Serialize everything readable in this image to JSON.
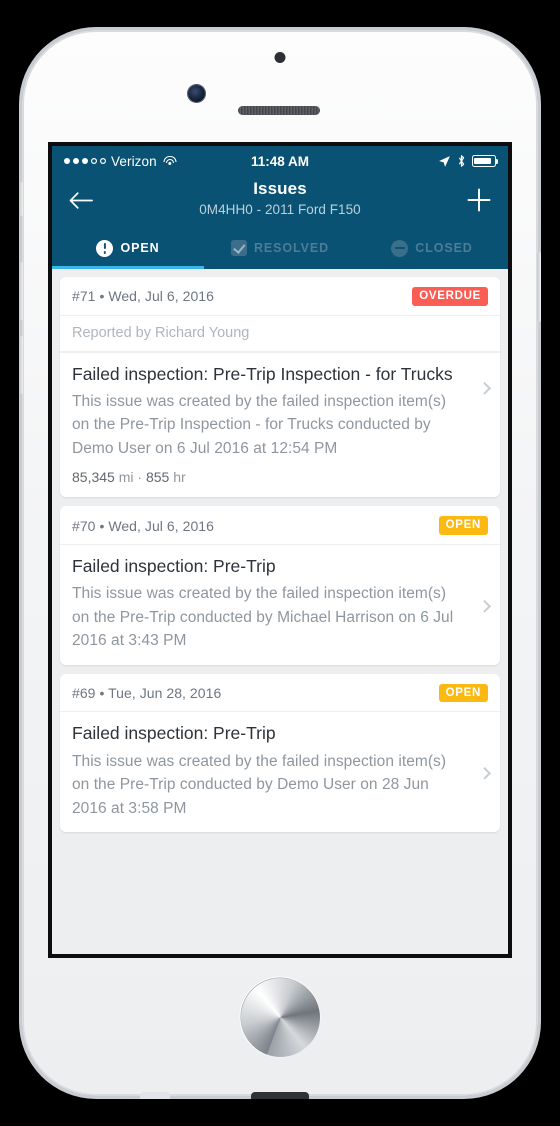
{
  "device": {
    "frame": "iphone-white"
  },
  "statusbar": {
    "carrier": "Verizon",
    "signal_filled": 3,
    "signal_total": 5,
    "time": "11:48 AM",
    "icons": [
      "location-arrow-icon",
      "bluetooth-icon",
      "battery-icon"
    ]
  },
  "navbar": {
    "back_icon": "arrow-left-icon",
    "title": "Issues",
    "subtitle": "0M4HH0 - 2011 Ford F150",
    "add_icon": "plus-icon"
  },
  "tabs": [
    {
      "label": "OPEN",
      "icon": "exclamation-circle-icon",
      "active": true
    },
    {
      "label": "RESOLVED",
      "icon": "checkbox-checked-icon",
      "active": false
    },
    {
      "label": "CLOSED",
      "icon": "minus-circle-icon",
      "active": false
    }
  ],
  "colors": {
    "header": "#0a5273",
    "accent_underline": "#38b6e8",
    "badge_overdue": "#f95d54",
    "badge_open": "#fdb913",
    "list_background": "#eceef0"
  },
  "issues": [
    {
      "number": "#71",
      "date": "Wed, Jul 6, 2016",
      "meta": "#71 • Wed, Jul 6, 2016",
      "badge": "OVERDUE",
      "badge_color": "#f95d54",
      "reported_by": "Reported by Richard Young",
      "title": "Failed inspection: Pre-Trip Inspection - for Trucks",
      "description": "This issue was created by the failed inspection item(s) on the Pre-Trip Inspection - for Trucks conducted by Demo User on 6 Jul 2016 at 12:54 PM",
      "meter_value": "85,345",
      "meter_unit": "mi",
      "hours_value": "855",
      "hours_unit": "hr",
      "meter_separator": "·"
    },
    {
      "number": "#70",
      "date": "Wed, Jul 6, 2016",
      "meta": "#70 • Wed, Jul 6, 2016",
      "badge": "OPEN",
      "badge_color": "#fdb913",
      "title": "Failed inspection: Pre-Trip",
      "description": "This issue was created by the failed inspection item(s) on the Pre-Trip conducted by Michael Harrison on 6 Jul 2016 at 3:43 PM"
    },
    {
      "number": "#69",
      "date": "Tue, Jun 28, 2016",
      "meta": "#69 • Tue, Jun 28, 2016",
      "badge": "OPEN",
      "badge_color": "#fdb913",
      "title": "Failed inspection: Pre-Trip",
      "description": "This issue was created by the failed inspection item(s) on the Pre-Trip conducted by Demo User on 28 Jun 2016 at 3:58 PM"
    }
  ]
}
